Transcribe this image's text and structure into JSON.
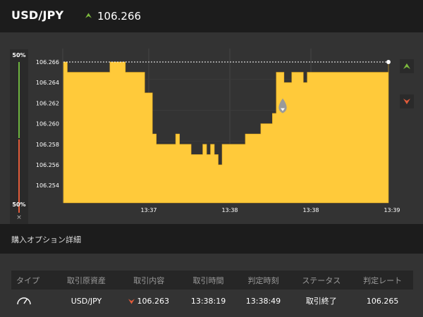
{
  "header": {
    "pair": "USD/JPY",
    "price": "106.266",
    "trend_icon": "up-arrow-icon",
    "accent_up": "#7dbb3e"
  },
  "gauge": {
    "top_label": "50%",
    "bottom_label": "50%",
    "close_label": "×",
    "up_color": "#6db33f",
    "down_color": "#e05b3a"
  },
  "side_buttons": {
    "up_icon": "up-arrow-icon",
    "down_icon": "down-arrow-icon",
    "up_color": "#7dbb3e",
    "down_color": "#e05b3a"
  },
  "chart_data": {
    "type": "area",
    "color": "#ffca3a",
    "ylim": [
      106.2523,
      106.2673
    ],
    "y_ticks": [
      "106.266",
      "106.264",
      "106.262",
      "106.260",
      "106.258",
      "106.256",
      "106.254"
    ],
    "x_ticks": [
      "13:37",
      "13:38",
      "13:38",
      "13:39"
    ],
    "current_rate": "106.266",
    "series": [
      {
        "values": [
          106.266,
          106.265,
          106.265,
          106.265,
          106.265,
          106.265,
          106.265,
          106.265,
          106.265,
          106.265,
          106.265,
          106.265,
          106.266,
          106.266,
          106.266,
          106.266,
          106.265,
          106.265,
          106.265,
          106.265,
          106.265,
          106.263,
          106.263,
          106.259,
          106.258,
          106.258,
          106.258,
          106.258,
          106.258,
          106.259,
          106.258,
          106.258,
          106.258,
          106.257,
          106.257,
          106.257,
          106.258,
          106.257,
          106.258,
          106.257,
          106.256,
          106.258,
          106.258,
          106.258,
          106.258,
          106.258,
          106.258,
          106.259,
          106.259,
          106.259,
          106.259,
          106.26,
          106.26,
          106.26,
          106.261,
          106.265,
          106.265,
          106.264,
          106.264,
          106.265,
          106.265,
          106.265,
          106.264,
          106.265,
          106.265,
          106.265,
          106.265,
          106.265,
          106.265,
          106.265,
          106.265,
          106.265,
          106.265,
          106.265,
          106.265,
          106.265,
          106.265,
          106.265,
          106.265,
          106.265,
          106.265,
          106.265,
          106.265,
          106.265,
          106.266
        ]
      }
    ]
  },
  "details": {
    "title": "購入オプション詳細",
    "columns": [
      "タイプ",
      "取引原資産",
      "取引内容",
      "取引時間",
      "判定時刻",
      "ステータス",
      "判定レート"
    ],
    "row": {
      "type_icon": "gauge-icon",
      "asset": "USD/JPY",
      "trade_icon": "down-arrow-icon",
      "trade_rate": "106.263",
      "trade_time": "13:38:19",
      "judge_time": "13:38:49",
      "status": "取引終了",
      "judge_rate": "106.265"
    }
  }
}
